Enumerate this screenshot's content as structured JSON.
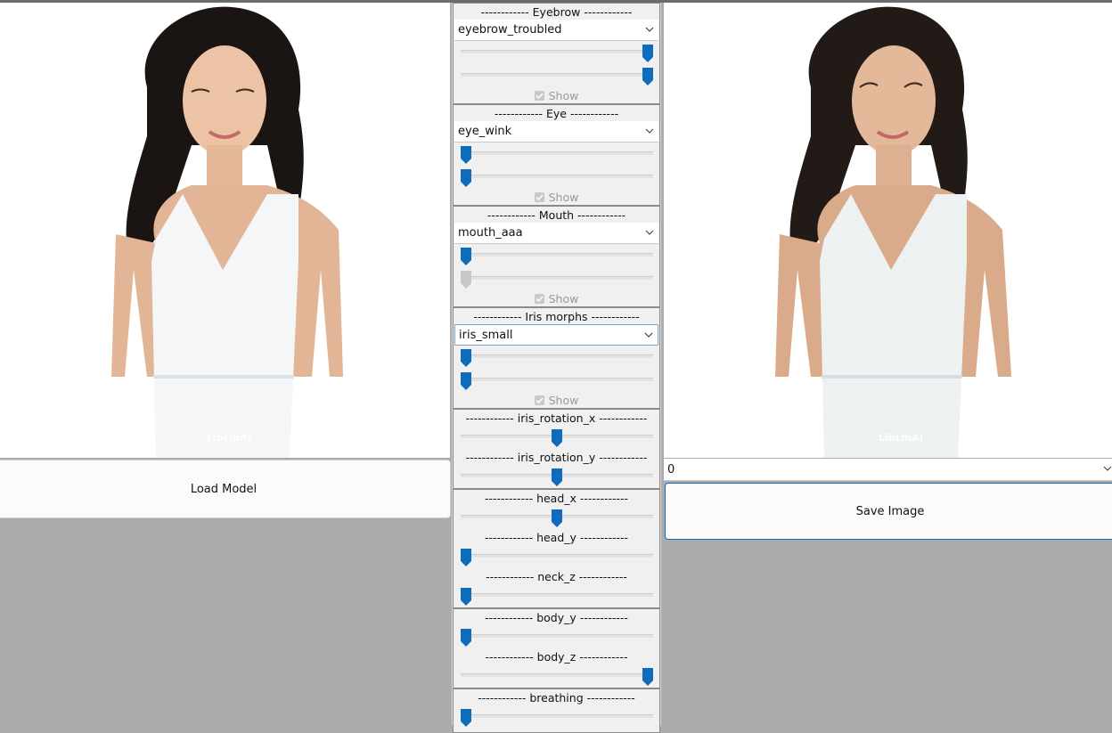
{
  "left_panel": {
    "load_button": "Load Model",
    "watermark": "LibLibAI"
  },
  "right_panel": {
    "combo_value": "0",
    "save_button": "Save Image",
    "watermark": "LibLibAI"
  },
  "groups": {
    "eyebrow": {
      "title": "------------ Eyebrow ------------",
      "select": "eyebrow_troubled",
      "slider1": 1.0,
      "slider2": 1.0,
      "show": "Show"
    },
    "eye": {
      "title": "------------ Eye ------------",
      "select": "eye_wink",
      "slider1": 0.0,
      "slider2": 0.0,
      "show": "Show"
    },
    "mouth": {
      "title": "------------ Mouth ------------",
      "select": "mouth_aaa",
      "slider1": 0.0,
      "slider2": 0.0,
      "slider2_disabled": true,
      "show": "Show"
    },
    "iris_morphs": {
      "title": "------------ Iris morphs ------------",
      "select": "iris_small",
      "slider1": 0.0,
      "slider2": 0.0,
      "show": "Show"
    },
    "iris_rotation": {
      "x_title": "------------ iris_rotation_x ------------",
      "x_value": 0.5,
      "y_title": "------------ iris_rotation_y ------------",
      "y_value": 0.5
    },
    "head": {
      "x_title": "------------ head_x ------------",
      "x_value": 0.5,
      "y_title": "------------ head_y ------------",
      "y_value": 0.0,
      "z_title": "------------ neck_z ------------",
      "z_value": 0.0
    },
    "body": {
      "y_title": "------------ body_y ------------",
      "y_value": 0.0,
      "z_title": "------------ body_z ------------",
      "z_value": 1.0
    },
    "breathing": {
      "title": "------------ breathing ------------",
      "value": 0.0
    }
  },
  "colors": {
    "slider_thumb": "#0f6cbd",
    "slider_thumb_disabled": "#c7c7c7",
    "background": "#ababab"
  }
}
